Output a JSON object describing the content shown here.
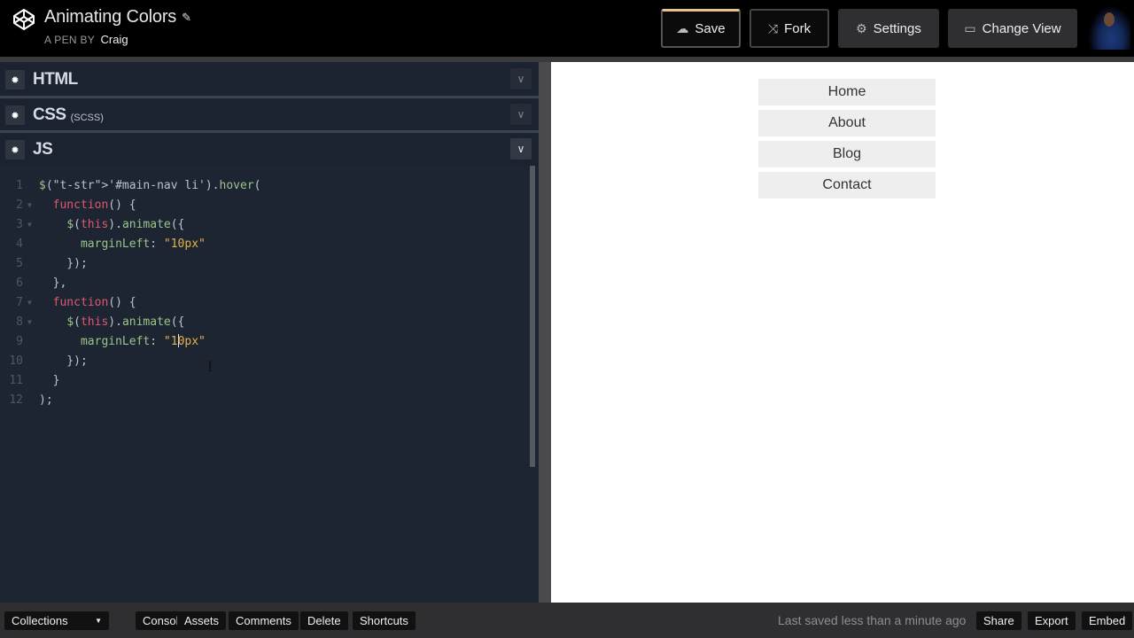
{
  "header": {
    "logo_icon": "codepen-logo-icon",
    "title": "Animating Colors",
    "edit_icon": "pencil-icon",
    "byline_prefix": "A PEN BY",
    "author": "Craig",
    "buttons": {
      "save": {
        "label": "Save",
        "icon": "cloud-icon"
      },
      "fork": {
        "label": "Fork",
        "icon": "fork-icon"
      },
      "settings": {
        "label": "Settings",
        "icon": "gear-icon"
      },
      "change_view": {
        "label": "Change View",
        "icon": "view-icon"
      }
    },
    "accent_color": "#e8c48c"
  },
  "editors": [
    {
      "name": "HTML",
      "sub": "",
      "collapsed": true
    },
    {
      "name": "CSS",
      "sub": "(SCSS)",
      "collapsed": true
    },
    {
      "name": "JS",
      "sub": "",
      "collapsed": false
    }
  ],
  "code": {
    "language": "js",
    "lines": [
      "$('#main-nav li').hover(",
      "  function() {",
      "    $(this).animate({",
      "      marginLeft: \"10px\"",
      "    });",
      "  },",
      "  function() {",
      "    $(this).animate({",
      "      marginLeft: \"10px\"",
      "    });",
      "  }",
      ");"
    ],
    "line_numbers": [
      "1",
      "2",
      "3",
      "4",
      "5",
      "6",
      "7",
      "8",
      "9",
      "10",
      "11",
      "12"
    ],
    "cursor_line": 9
  },
  "preview": {
    "nav_items": [
      "Home",
      "About",
      "Blog",
      "Contact"
    ]
  },
  "footer": {
    "collections_label": "Collections",
    "left_buttons": [
      "Console",
      "Assets",
      "Comments",
      "Delete",
      "Shortcuts"
    ],
    "status": "Last saved less than a minute ago",
    "right_buttons": [
      "Share",
      "Export",
      "Embed"
    ]
  }
}
